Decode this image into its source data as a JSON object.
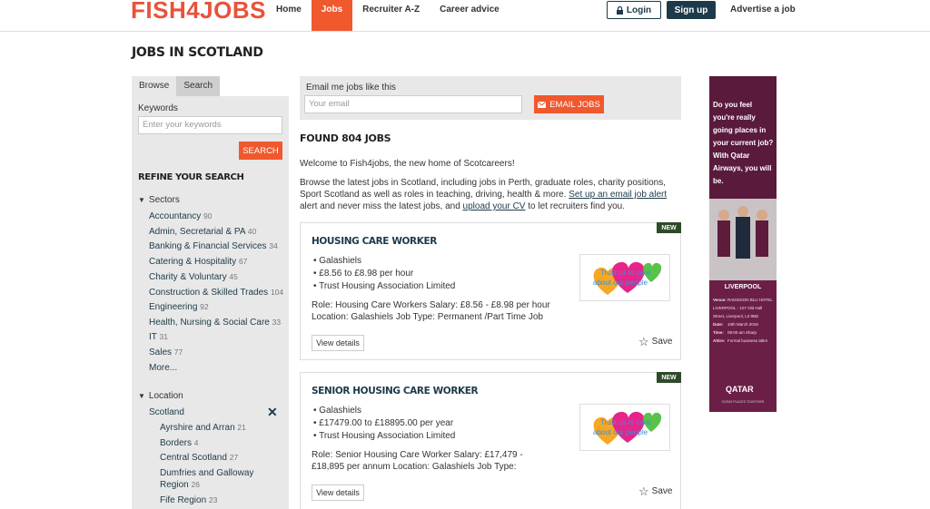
{
  "header": {
    "logo_text": "FISH4JOBS",
    "nav": [
      "Home",
      "Jobs",
      "Recruiter A-Z",
      "Career advice"
    ],
    "login": "Login",
    "signup": "Sign up",
    "advertise": "Advertise a job"
  },
  "page_title": "JOBS IN SCOTLAND",
  "sidebar": {
    "tabs": [
      "Browse",
      "Search"
    ],
    "keywords_label": "Keywords",
    "keywords_placeholder": "Enter your keywords",
    "search_button": "SEARCH",
    "refine_title": "REFINE YOUR SEARCH",
    "sectors_title": "Sectors",
    "sectors": [
      {
        "label": "Accountancy",
        "count": "90"
      },
      {
        "label": "Admin, Secretarial & PA",
        "count": "40"
      },
      {
        "label": "Banking & Financial Services",
        "count": "34"
      },
      {
        "label": "Catering & Hospitality",
        "count": "67"
      },
      {
        "label": "Charity & Voluntary",
        "count": "45"
      },
      {
        "label": "Construction & Skilled Trades",
        "count": "104"
      },
      {
        "label": "Engineering",
        "count": "92"
      },
      {
        "label": "Health, Nursing & Social Care",
        "count": "33"
      },
      {
        "label": "IT",
        "count": "31"
      },
      {
        "label": "Sales",
        "count": "77"
      },
      {
        "label": "More...",
        "count": ""
      }
    ],
    "location_title": "Location",
    "location_selected": "Scotland",
    "locations": [
      {
        "label": "Ayrshire and Arran",
        "count": "21"
      },
      {
        "label": "Borders",
        "count": "4"
      },
      {
        "label": "Central Scotland",
        "count": "27"
      },
      {
        "label": "Dumfries and Galloway Region",
        "count": "26"
      },
      {
        "label": "Fife Region",
        "count": "23"
      }
    ]
  },
  "email_alert": {
    "label": "Email me jobs like this",
    "placeholder": "Your email",
    "button": "EMAIL JOBS"
  },
  "found": "FOUND 804 JOBS",
  "welcome": "Welcome to Fish4jobs, the new home of Scotcareers!",
  "browse_text_1": "Browse the latest jobs in Scotland, including jobs in Perth, graduate roles, charity positions, Sport Scotland as well as roles in teaching, driving, health & more. ",
  "browse_link_1": "Set up an email job alert",
  "browse_text_2": " alert and never miss the latest jobs, and ",
  "browse_link_2": "upload your CV",
  "browse_text_3": " to let recruiters find you.",
  "jobs": [
    {
      "badge": "NEW",
      "title": "HOUSING CARE WORKER",
      "location": "Galashiels",
      "salary": "£8.56 to £8.98 per hour",
      "company": "Trust Housing Association Limited",
      "description": "Role: Housing Care Workers Salary: £8.56 - £8.98 per hour Location: Galashiels Job Type: Permanent /Part Time Job",
      "view": "View details",
      "save": "Save",
      "logo_line1": "Trust us to care",
      "logo_line2": "about our people"
    },
    {
      "badge": "NEW",
      "title": "SENIOR HOUSING CARE WORKER",
      "location": "Galashiels",
      "salary": "£17479.00 to £18895.00 per year",
      "company": "Trust Housing Association Limited",
      "description": "Role: Senior Housing Care Worker           Salary: £17,479 - £18,895 per annum        Location: Galashiels   Job Type:",
      "view": "View details",
      "save": "Save",
      "logo_line1": "Trust us to care",
      "logo_line2": "about our people"
    }
  ],
  "ad": {
    "headline": "Do you feel you're really going places in your current job? With Qatar Airways, you will be.",
    "city": "LIVERPOOL",
    "venue_k": "Venue:",
    "venue_v": "RADISSON BLU HOTEL LIVERPOOL - 107 Old Hall Street, Liverpool, L3 9BD",
    "date_k": "Date:",
    "date_v": "10th March 2018",
    "time_k": "Time:",
    "time_v": "09:00 am Sharp",
    "attire_k": "Attire:",
    "attire_v": "Formal business attire",
    "brand": "QATAR",
    "tagline": "GOING PLACES TOGETHER"
  },
  "colors": {
    "accent": "#f0582e",
    "navy": "#1d3a4a",
    "ad_bg": "#6b1f47"
  }
}
